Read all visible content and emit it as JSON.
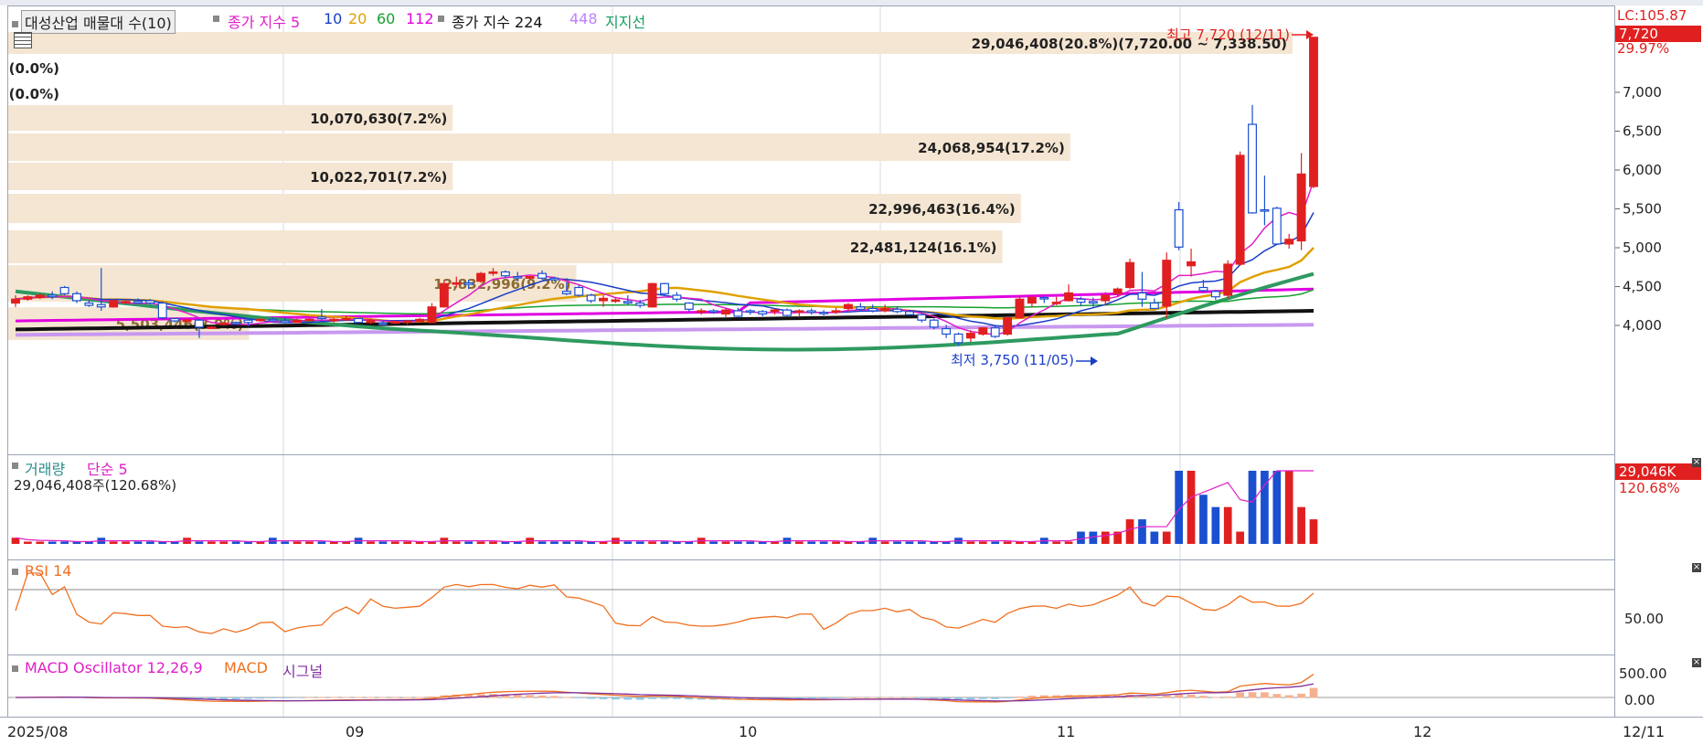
{
  "legend_main": {
    "item1": "대성산업 매물대 수(10)",
    "ma_label": "종가 지수 5",
    "ma_10": "10",
    "ma_20": "20",
    "ma_60": "60",
    "ma_112": "112",
    "ma2_label": "종가 지수 224",
    "ma_448": "448",
    "support": "지지선"
  },
  "header_right": {
    "lc": "LC:105.87",
    "price": "7,720",
    "pct": "29.97%"
  },
  "price_axis_ticks": [
    "7,000",
    "6,500",
    "6,000",
    "5,500",
    "5,000",
    "4,500",
    "4,000"
  ],
  "volume_profile": [
    {
      "label": "29,046,408(20.8%)(7,720.00 ~ 7,338.50)",
      "pct": 20.8
    },
    {
      "label": "0(0.0%)",
      "pct": 0
    },
    {
      "label": "0(0.0%)",
      "pct": 0
    },
    {
      "label": "10,070,630(7.2%)",
      "pct": 7.2
    },
    {
      "label": "24,068,954(17.2%)",
      "pct": 17.2
    },
    {
      "label": "10,022,701(7.2%)",
      "pct": 7.2
    },
    {
      "label": "22,996,463(16.4%)",
      "pct": 16.4
    },
    {
      "label": "22,481,124(16.1%)",
      "pct": 16.1
    },
    {
      "label": "12,832,996(9.2%)",
      "pct": 9.2
    },
    {
      "label": "5,503,446(3.9%)",
      "pct": 3.9
    }
  ],
  "annotations": {
    "high": "최고 7,720 (12/11)",
    "low": "최저 3,750 (11/05)"
  },
  "volume_panel": {
    "title": "거래량",
    "ma": "단순 5",
    "value": "29,046,408주(120.68%)",
    "right_value": "29,046K",
    "right_pct": "120.68%"
  },
  "rsi_panel": {
    "title": "RSI 14",
    "tick": "50.00"
  },
  "macd_panel": {
    "title": "MACD Oscillator 12,26,9",
    "macd": "MACD",
    "signal": "시그널",
    "ticks": [
      "500.00",
      "0.00"
    ]
  },
  "x_axis": {
    "labels": [
      "2025/08",
      "09",
      "10",
      "11",
      "12"
    ],
    "right": "12/11"
  },
  "chart_data": {
    "type": "candlestick",
    "title": "대성산업",
    "ylim": [
      3500,
      7800
    ],
    "candles": [
      [
        4300,
        4400,
        4250,
        4350
      ],
      [
        4350,
        4400,
        4330,
        4380
      ],
      [
        4370,
        4420,
        4350,
        4400
      ],
      [
        4400,
        4450,
        4350,
        4380
      ],
      [
        4500,
        4520,
        4400,
        4420
      ],
      [
        4420,
        4450,
        4300,
        4330
      ],
      [
        4300,
        4340,
        4250,
        4270
      ],
      [
        4280,
        4750,
        4200,
        4250
      ],
      [
        4250,
        4350,
        4240,
        4330
      ],
      [
        4320,
        4350,
        4300,
        4320
      ],
      [
        4320,
        4360,
        4290,
        4300
      ],
      [
        4330,
        4350,
        4280,
        4300
      ],
      [
        4300,
        4320,
        4090,
        4110
      ],
      [
        4100,
        4110,
        4050,
        4070
      ],
      [
        4080,
        4100,
        4050,
        4080
      ],
      [
        4080,
        4100,
        3850,
        3990
      ],
      [
        3990,
        4000,
        3970,
        3990
      ],
      [
        4040,
        4060,
        4010,
        4040
      ],
      [
        4050,
        4060,
        4020,
        4040
      ],
      [
        4080,
        4100,
        4000,
        4050
      ],
      [
        4080,
        4100,
        4060,
        4090
      ],
      [
        4090,
        4110,
        4060,
        4080
      ],
      [
        4070,
        4120,
        4040,
        4050
      ],
      [
        4050,
        4100,
        4040,
        4080
      ],
      [
        4080,
        4100,
        4060,
        4090
      ],
      [
        4120,
        4220,
        4080,
        4100
      ],
      [
        4070,
        4110,
        4050,
        4090
      ],
      [
        4100,
        4140,
        4080,
        4100
      ],
      [
        4100,
        4110,
        4040,
        4050
      ],
      [
        4050,
        4100,
        4030,
        4080
      ],
      [
        4040,
        4070,
        4020,
        4030
      ],
      [
        4060,
        4080,
        4030,
        4060
      ],
      [
        4050,
        4080,
        4020,
        4070
      ],
      [
        4060,
        4110,
        4050,
        4090
      ],
      [
        4050,
        4300,
        4050,
        4250
      ],
      [
        4250,
        4600,
        4240,
        4550
      ],
      [
        4560,
        4640,
        4500,
        4560
      ],
      [
        4560,
        4600,
        4480,
        4540
      ],
      [
        4580,
        4700,
        4560,
        4680
      ],
      [
        4700,
        4750,
        4650,
        4700
      ],
      [
        4700,
        4720,
        4620,
        4650
      ],
      [
        4640,
        4700,
        4580,
        4630
      ],
      [
        4620,
        4650,
        4600,
        4640
      ],
      [
        4680,
        4720,
        4600,
        4620
      ],
      [
        4620,
        4640,
        4580,
        4600
      ],
      [
        4450,
        4570,
        4400,
        4420
      ],
      [
        4500,
        4530,
        4380,
        4400
      ],
      [
        4400,
        4420,
        4300,
        4330
      ],
      [
        4330,
        4400,
        4250,
        4360
      ],
      [
        4340,
        4370,
        4300,
        4340
      ],
      [
        4320,
        4400,
        4280,
        4300
      ],
      [
        4300,
        4340,
        4240,
        4270
      ],
      [
        4250,
        4560,
        4240,
        4550
      ],
      [
        4550,
        4560,
        4400,
        4420
      ],
      [
        4400,
        4440,
        4320,
        4350
      ],
      [
        4300,
        4310,
        4190,
        4220
      ],
      [
        4200,
        4230,
        4150,
        4200
      ],
      [
        4200,
        4220,
        4160,
        4190
      ],
      [
        4160,
        4230,
        4120,
        4210
      ],
      [
        4200,
        4240,
        4110,
        4130
      ],
      [
        4200,
        4220,
        4150,
        4190
      ],
      [
        4190,
        4210,
        4130,
        4160
      ],
      [
        4200,
        4230,
        4150,
        4210
      ],
      [
        4210,
        4230,
        4130,
        4140
      ],
      [
        4190,
        4220,
        4120,
        4200
      ],
      [
        4200,
        4230,
        4150,
        4180
      ],
      [
        4180,
        4210,
        4140,
        4170
      ],
      [
        4190,
        4240,
        4160,
        4200
      ],
      [
        4230,
        4300,
        4200,
        4280
      ],
      [
        4250,
        4300,
        4190,
        4220
      ],
      [
        4230,
        4280,
        4180,
        4200
      ],
      [
        4200,
        4280,
        4180,
        4230
      ],
      [
        4220,
        4260,
        4170,
        4190
      ],
      [
        4190,
        4210,
        4140,
        4150
      ],
      [
        4150,
        4170,
        4050,
        4080
      ],
      [
        4080,
        4100,
        3960,
        3990
      ],
      [
        3970,
        4020,
        3850,
        3900
      ],
      [
        3900,
        3920,
        3750,
        3790
      ],
      [
        3850,
        3950,
        3800,
        3910
      ],
      [
        3900,
        3990,
        3880,
        3980
      ],
      [
        3980,
        4020,
        3850,
        3870
      ],
      [
        3900,
        4130,
        3880,
        4110
      ],
      [
        4110,
        4400,
        4100,
        4350
      ],
      [
        4300,
        4400,
        4250,
        4370
      ],
      [
        4370,
        4390,
        4300,
        4360
      ],
      [
        4300,
        4380,
        4270,
        4310
      ],
      [
        4330,
        4540,
        4320,
        4430
      ],
      [
        4350,
        4380,
        4260,
        4310
      ],
      [
        4320,
        4370,
        4250,
        4300
      ],
      [
        4330,
        4440,
        4270,
        4400
      ],
      [
        4420,
        4500,
        4380,
        4480
      ],
      [
        4500,
        4870,
        4480,
        4820
      ],
      [
        4430,
        4700,
        4250,
        4350
      ],
      [
        4300,
        4360,
        4220,
        4230
      ],
      [
        4260,
        4950,
        4100,
        4850
      ],
      [
        5500,
        5600,
        4980,
        5020
      ],
      [
        4780,
        5000,
        4640,
        4830
      ],
      [
        4500,
        4600,
        4430,
        4460
      ],
      [
        4450,
        4470,
        4340,
        4380
      ],
      [
        4400,
        4850,
        4350,
        4800
      ],
      [
        4800,
        6250,
        4780,
        6200
      ],
      [
        6600,
        6850,
        5450,
        5460
      ],
      [
        5500,
        5940,
        5300,
        5490
      ],
      [
        5520,
        5540,
        5050,
        5060
      ],
      [
        5060,
        5190,
        5000,
        5120
      ],
      [
        5100,
        6230,
        4980,
        5960
      ],
      [
        5800,
        7720,
        5780,
        7720
      ]
    ]
  }
}
